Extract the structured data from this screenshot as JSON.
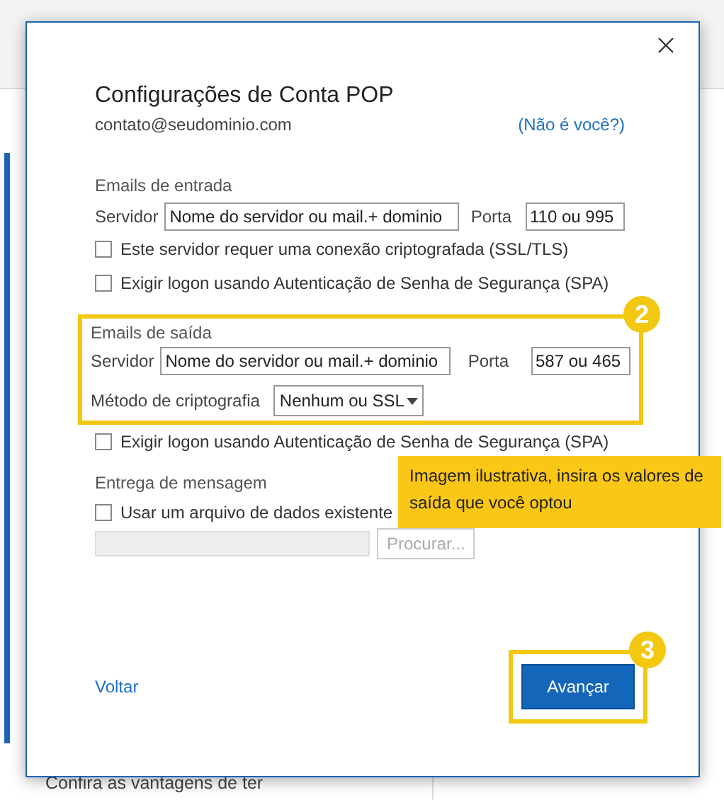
{
  "background": {
    "promo_text": "Confira as vantagens de ter"
  },
  "dialog": {
    "title": "Configurações de Conta POP",
    "account": "contato@seudominio.com",
    "not_you_link": "(Não é você?)",
    "incoming": {
      "heading": "Emails de entrada",
      "server_label": "Servidor",
      "server_value": "Nome do servidor ou mail.+ dominio",
      "port_label": "Porta",
      "port_value": "110 ou 995",
      "options": [
        {
          "label": "Este servidor requer uma conexão criptografada (SSL/TLS)",
          "checked": false
        },
        {
          "label": "Exigir logon usando Autenticação de Senha de Segurança (SPA)",
          "checked": false
        }
      ]
    },
    "outgoing": {
      "heading": "Emails de saída",
      "server_label": "Servidor",
      "server_value": "Nome do servidor ou mail.+ dominio",
      "port_label": "Porta",
      "port_value": "587 ou 465",
      "encryption_label": "Método de criptografia",
      "encryption_value": "Nenhum ou SSL",
      "badge": "2"
    },
    "outgoing_options": [
      {
        "label": "Exigir logon usando Autenticação de Senha de Segurança (SPA)",
        "checked": false
      }
    ],
    "delivery": {
      "heading": "Entrega de mensagem",
      "options": [
        {
          "label": "Usar um arquivo de dados existente",
          "checked": false
        }
      ],
      "browse_button": "Procurar...",
      "disabled": true
    },
    "back_link": "Voltar",
    "next_button": "Avançar",
    "next_badge": "3"
  },
  "callout": {
    "text": "Imagem ilustrativa, insira os valores de saída que você optou"
  }
}
